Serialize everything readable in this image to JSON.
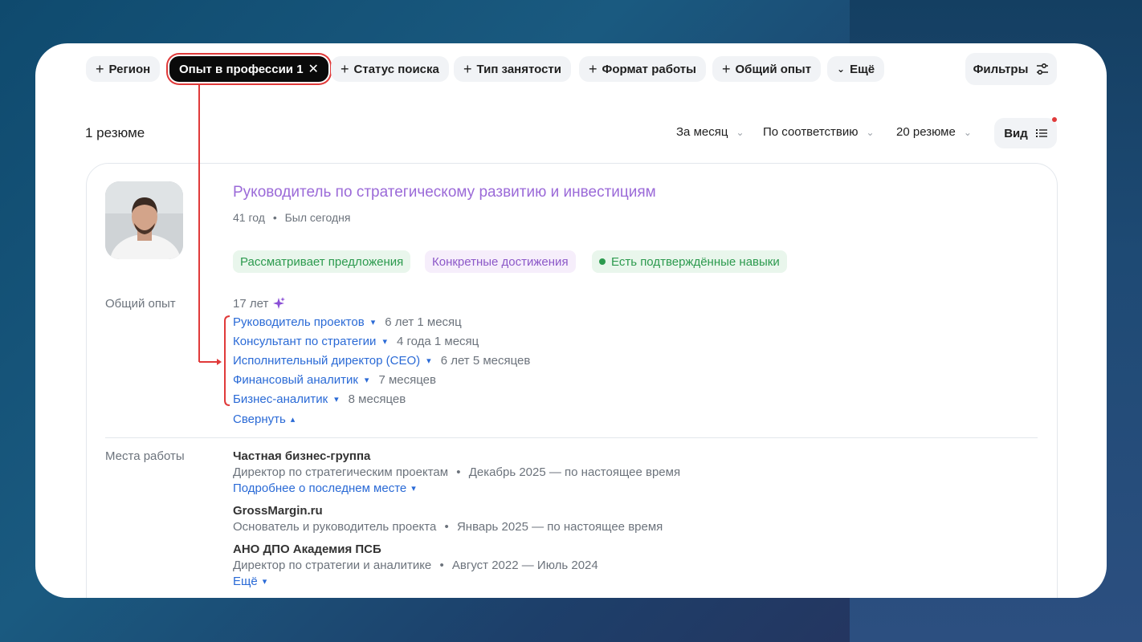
{
  "filters": {
    "chips": [
      {
        "label": "Регион"
      },
      {
        "label": "Опыт в профессии 1",
        "active": true
      },
      {
        "label": "Статус поиска"
      },
      {
        "label": "Тип занятости"
      },
      {
        "label": "Формат работы"
      },
      {
        "label": "Общий опыт"
      },
      {
        "label": "Ещё"
      }
    ],
    "filters_button": "Фильтры"
  },
  "results": {
    "count": "1 резюме",
    "period": "За месяц",
    "sort": "По соответствию",
    "page_size": "20 резюме",
    "view": "Вид"
  },
  "resume": {
    "title": "Руководитель по стратегическому развитию и инвестициям",
    "age": "41 год",
    "last_seen": "Был сегодня",
    "tags": [
      "Рассматривает предложения",
      "Конкретные достижения",
      "Есть подтверждённые навыки"
    ],
    "experience_label": "Общий опыт",
    "experience_total": "17 лет",
    "roles": [
      {
        "name": "Руководитель проектов",
        "duration": "6 лет 1 месяц"
      },
      {
        "name": "Консультант по стратегии",
        "duration": "4 года 1 месяц"
      },
      {
        "name": "Исполнительный директор (CEO)",
        "duration": "6 лет 5 месяцев"
      },
      {
        "name": "Финансовый аналитик",
        "duration": "7 месяцев"
      },
      {
        "name": "Бизнес-аналитик",
        "duration": "8 месяцев"
      }
    ],
    "collapse_label": "Свернуть",
    "workplaces_label": "Места работы",
    "jobs": [
      {
        "company": "Частная бизнес-группа",
        "position": "Директор по стратегическим проектам",
        "period": "Декабрь 2025 — по настоящее время"
      },
      {
        "company": "GrossMargin.ru",
        "position": "Основатель и руководитель проекта",
        "period": "Январь 2025 — по настоящее время"
      },
      {
        "company": "АНО ДПО Академия ПСБ",
        "position": "Директор по стратегии и аналитике",
        "period": "Август 2022 — Июль 2024"
      }
    ],
    "more_last_place": "Подробнее о последнем месте",
    "more": "Ещё"
  },
  "colors": {
    "accent_link": "#2a6ad6",
    "title": "#9b6ad8",
    "annotation": "#e03a3a"
  },
  "icons": [
    "plus-icon",
    "close-icon",
    "chevron-down-icon",
    "sliders-icon",
    "list-view-icon",
    "sparkle-icon",
    "chevron-up-icon"
  ]
}
